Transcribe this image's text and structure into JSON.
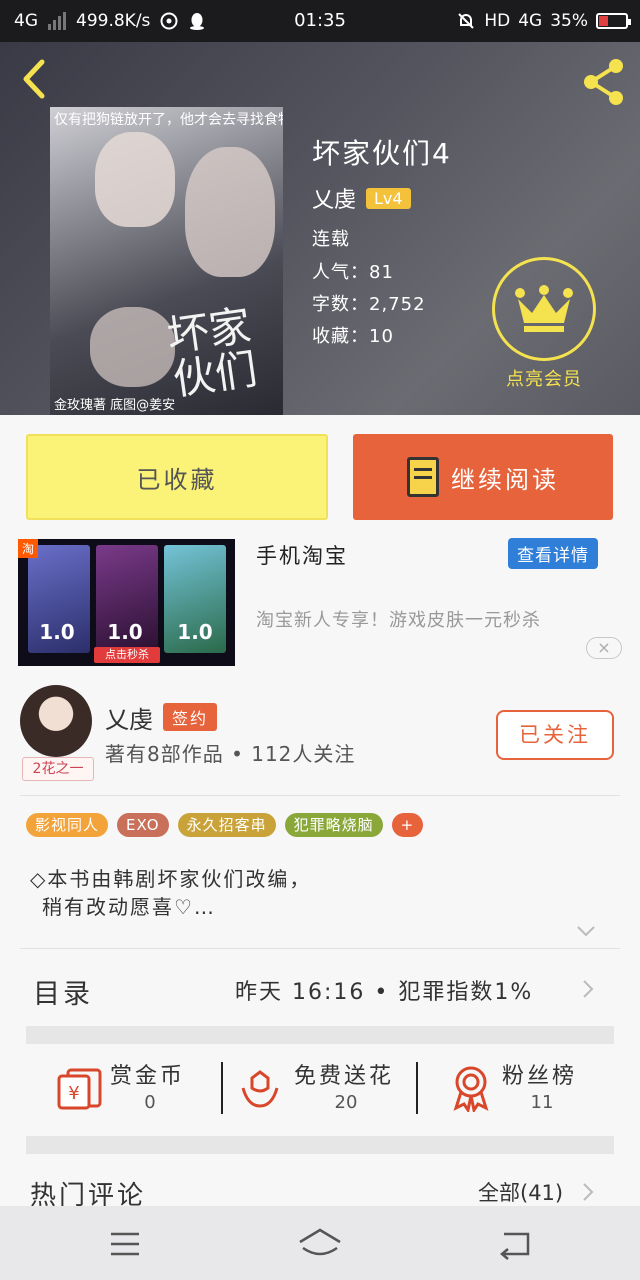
{
  "status_bar": {
    "network": "4G",
    "speed": "499.8K/s",
    "time": "01:35",
    "hd": "HD",
    "network_right": "4G",
    "battery": "35%"
  },
  "book": {
    "title": "坏家伙们4",
    "author": "乂虔",
    "level": "Lv4",
    "status": "连载",
    "popularity": "人气：81",
    "word_count": "字数：2,752",
    "favorites": "收藏：10",
    "cover": {
      "top_text": "仅有把狗链放开了，他才会去寻找食物",
      "title_text": "坏家伙们",
      "bottom_text": "金玫瑰著  底图@姜安"
    }
  },
  "vip": {
    "label": "点亮会员"
  },
  "actions": {
    "collected": "已收藏",
    "continue_reading": "继续阅读"
  },
  "ad": {
    "source_tag": "淘",
    "prices": [
      "1.0",
      "1.0",
      "1.0"
    ],
    "price_unit": "秒杀",
    "cta": "点击秒杀",
    "title": "手机淘宝",
    "detail_button": "查看详情",
    "description": "淘宝新人专享！游戏皮肤一元秒杀",
    "close": "×"
  },
  "author": {
    "name": "乂虔",
    "sign_badge": "签约",
    "avatar_badge": "2花之一",
    "stats": "著有8部作品 • 112人关注",
    "follow_button": "已关注"
  },
  "tags": [
    {
      "label": "影视同人",
      "color": "#f2a33a"
    },
    {
      "label": "EXO",
      "color": "#c9705a"
    },
    {
      "label": "永久招客串",
      "color": "#c9a23a"
    },
    {
      "label": "犯罪略烧脑",
      "color": "#8aa83a"
    },
    {
      "label": "+",
      "color": "#e7633b"
    }
  ],
  "description": {
    "line1": "◇本书由韩剧坏家伙们改编，",
    "line2": "稍有改动愿喜♡…"
  },
  "catalog": {
    "title": "目录",
    "info": "昨天 16:16 • 犯罪指数1%"
  },
  "stats": [
    {
      "label": "赏金币",
      "value": "0"
    },
    {
      "label": "免费送花",
      "value": "20"
    },
    {
      "label": "粉丝榜",
      "value": "11"
    }
  ],
  "comments": {
    "title": "热门评论",
    "all": "全部(41)"
  },
  "colors": {
    "accent_orange": "#e7633b",
    "collected_yellow": "#fbf278",
    "vip_gold": "#f5e24f",
    "detail_blue": "#2f7fd9"
  }
}
